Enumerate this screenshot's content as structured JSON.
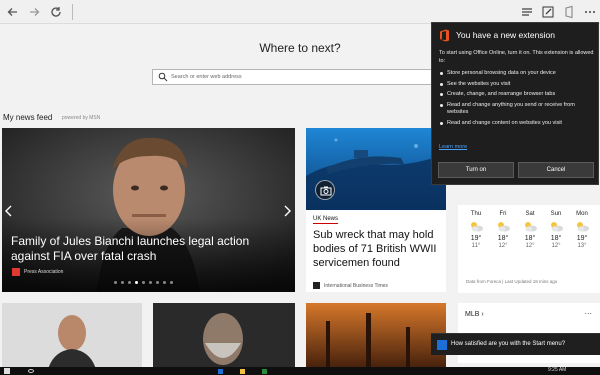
{
  "toolbar": {
    "back_icon": "back-arrow-icon",
    "forward_icon": "forward-arrow-icon",
    "refresh_icon": "refresh-icon",
    "hub_icon": "hub-icon",
    "webnote_icon": "web-note-icon",
    "office_ext_icon": "office-extension-icon",
    "more_icon": "more-ellipsis-icon"
  },
  "newtab": {
    "heading": "Where to next?",
    "search_placeholder": "Search or enter web address"
  },
  "feed": {
    "title": "My news feed",
    "powered": "powered by MSN",
    "hero": {
      "title": "Family of Jules Bianchi launches legal action against FIA over fatal crash",
      "source": "Press Association",
      "slide_count": 9,
      "active_slide": 3
    },
    "card2": {
      "tag": "UK News",
      "title": "Sub wreck that may hold bodies of 71 British WWII servicemen found",
      "source": "International Business Times"
    }
  },
  "weather": {
    "days": [
      {
        "name": "Thu",
        "hi": "19°",
        "lo": "11°"
      },
      {
        "name": "Fri",
        "hi": "18°",
        "lo": "12°"
      },
      {
        "name": "Sat",
        "hi": "18°",
        "lo": "12°"
      },
      {
        "name": "Sun",
        "hi": "18°",
        "lo": "12°"
      },
      {
        "name": "Mon",
        "hi": "19°",
        "lo": "13°"
      }
    ],
    "footer": "Data from Foreca | Last Updated 18 mins ago"
  },
  "mlb": {
    "label": "MLB ›",
    "more": "..."
  },
  "extension_popup": {
    "title": "You have a new extension",
    "intro": "To start using Office Online, turn it on. This extension is allowed to:",
    "permissions": [
      "Store personal browsing data on your device",
      "See the websites you visit",
      "Create, change, and rearrange browser tabs",
      "Read and change anything you send or receive from websites",
      "Read and change content on websites you visit"
    ],
    "learn_more": "Learn more",
    "turn_on": "Turn on",
    "cancel": "Cancel"
  },
  "toast": {
    "text": "How satisfied are you with the Start menu?"
  },
  "taskbar": {
    "time": "9:25 AM"
  },
  "colors": {
    "popup_bg": "#1e1e1e",
    "link": "#4aa3ff",
    "office_orange": "#e8531f",
    "accent_red": "#c00000"
  }
}
